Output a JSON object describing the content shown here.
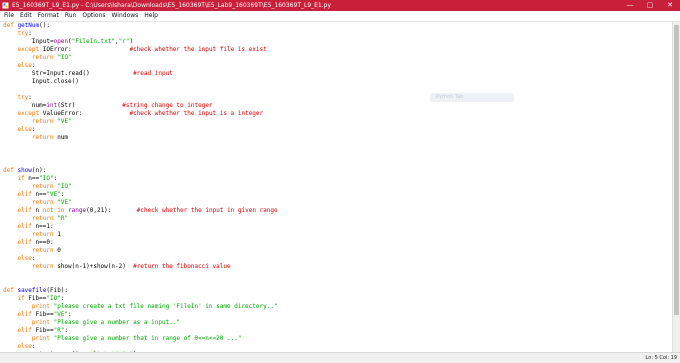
{
  "window": {
    "title": "E5_160369T_L9_E1.py - C:\\Users\\Ishara\\Downloads\\E5_160369T\\E5_Lab9_160369T\\E5_160369T_L9_E1.py",
    "buttons": {
      "minimize": "—",
      "maximize": "▢",
      "close": "✕"
    }
  },
  "menu": [
    "File",
    "Edit",
    "Format",
    "Run",
    "Options",
    "Windows",
    "Help"
  ],
  "ghost_label": "Python Tab",
  "status": {
    "position": "Ln: 5 Col: 19"
  },
  "theme": {
    "title_bg": "#c8203a",
    "keyword": "#ff7700",
    "builtin": "#900090",
    "string": "#00aa00",
    "comment": "#dd0000",
    "defname": "#0000ff"
  },
  "icons": {
    "app": "python-file-icon"
  },
  "code_lines": [
    [
      [
        "kw",
        "def "
      ],
      [
        "df",
        "getNum"
      ],
      [
        "",
        "():"
      ]
    ],
    [
      [
        "",
        "    "
      ],
      [
        "kw",
        "try"
      ],
      [
        "",
        ":"
      ]
    ],
    [
      [
        "",
        "        Input="
      ],
      [
        "bi",
        "open"
      ],
      [
        "",
        "("
      ],
      [
        "st",
        "\"FileIn.txt\""
      ],
      [
        "",
        ","
      ],
      [
        "st",
        "\"r\""
      ],
      [
        "",
        ")"
      ]
    ],
    [
      [
        "",
        "    "
      ],
      [
        "kw",
        "except"
      ],
      [
        "",
        " IOError:"
      ],
      [
        "",
        "                "
      ],
      [
        "cm",
        "#check whether the input file is exist"
      ]
    ],
    [
      [
        "",
        "        "
      ],
      [
        "kw",
        "return"
      ],
      [
        "",
        " "
      ],
      [
        "st",
        "\"IO\""
      ]
    ],
    [
      [
        "",
        "    "
      ],
      [
        "kw",
        "else"
      ],
      [
        "",
        ":"
      ]
    ],
    [
      [
        "",
        "        Str=Input.read()"
      ],
      [
        "",
        "            "
      ],
      [
        "cm",
        "#read input"
      ]
    ],
    [
      [
        "",
        "        Input.close()"
      ]
    ],
    [],
    [
      [
        "",
        "    "
      ],
      [
        "kw",
        "try"
      ],
      [
        "",
        ":"
      ]
    ],
    [
      [
        "",
        "        num="
      ],
      [
        "bi",
        "int"
      ],
      [
        "",
        "(Str)"
      ],
      [
        "",
        "             "
      ],
      [
        "cm",
        "#string change to integer"
      ]
    ],
    [
      [
        "",
        "    "
      ],
      [
        "kw",
        "except"
      ],
      [
        "",
        " ValueError:"
      ],
      [
        "",
        "             "
      ],
      [
        "cm",
        "#check whether the input is a integer"
      ]
    ],
    [
      [
        "",
        "        "
      ],
      [
        "kw",
        "return"
      ],
      [
        "",
        " "
      ],
      [
        "st",
        "\"VE\""
      ]
    ],
    [
      [
        "",
        "    "
      ],
      [
        "kw",
        "else"
      ],
      [
        "",
        ":"
      ]
    ],
    [
      [
        "",
        "        "
      ],
      [
        "kw",
        "return"
      ],
      [
        "",
        " num"
      ]
    ],
    [],
    [],
    [],
    [
      [
        "kw",
        "def "
      ],
      [
        "df",
        "show"
      ],
      [
        "",
        "(n):"
      ]
    ],
    [
      [
        "",
        "    "
      ],
      [
        "kw",
        "if"
      ],
      [
        "",
        " n=="
      ],
      [
        "st",
        "\"IO\""
      ],
      [
        "",
        ":"
      ]
    ],
    [
      [
        "",
        "        "
      ],
      [
        "kw",
        "return"
      ],
      [
        "",
        " "
      ],
      [
        "st",
        "\"IO\""
      ]
    ],
    [
      [
        "",
        "    "
      ],
      [
        "kw",
        "elif"
      ],
      [
        "",
        " n=="
      ],
      [
        "st",
        "\"VE\""
      ],
      [
        "",
        ":"
      ]
    ],
    [
      [
        "",
        "        "
      ],
      [
        "kw",
        "return"
      ],
      [
        "",
        " "
      ],
      [
        "st",
        "\"VE\""
      ]
    ],
    [
      [
        "",
        "    "
      ],
      [
        "kw",
        "elif"
      ],
      [
        "",
        " n "
      ],
      [
        "kw",
        "not in"
      ],
      [
        "",
        " "
      ],
      [
        "bi",
        "range"
      ],
      [
        "",
        "(0,21):"
      ],
      [
        "",
        "       "
      ],
      [
        "cm",
        "#check whether the input in given range"
      ]
    ],
    [
      [
        "",
        "        "
      ],
      [
        "kw",
        "return"
      ],
      [
        "",
        " "
      ],
      [
        "st",
        "\"R\""
      ]
    ],
    [
      [
        "",
        "    "
      ],
      [
        "kw",
        "elif"
      ],
      [
        "",
        " n==1:"
      ]
    ],
    [
      [
        "",
        "        "
      ],
      [
        "kw",
        "return"
      ],
      [
        "",
        " 1"
      ]
    ],
    [
      [
        "",
        "    "
      ],
      [
        "kw",
        "elif"
      ],
      [
        "",
        " n==0:"
      ]
    ],
    [
      [
        "",
        "        "
      ],
      [
        "kw",
        "return"
      ],
      [
        "",
        " 0"
      ]
    ],
    [
      [
        "",
        "    "
      ],
      [
        "kw",
        "else"
      ],
      [
        "",
        ":"
      ]
    ],
    [
      [
        "",
        "        "
      ],
      [
        "kw",
        "return"
      ],
      [
        "",
        " show(n-1)+show(n-2)"
      ],
      [
        "",
        "  "
      ],
      [
        "cm",
        "#return the fibonacci value"
      ]
    ],
    [],
    [],
    [
      [
        "kw",
        "def "
      ],
      [
        "df",
        "savefile"
      ],
      [
        "",
        "(Fib):"
      ]
    ],
    [
      [
        "",
        "    "
      ],
      [
        "kw",
        "if"
      ],
      [
        "",
        " Fib=="
      ],
      [
        "st",
        "\"IO\""
      ],
      [
        "",
        ":"
      ]
    ],
    [
      [
        "",
        "        "
      ],
      [
        "kw",
        "print"
      ],
      [
        "",
        " "
      ],
      [
        "st",
        "\"please create a txt file naming 'FileIn' in same directory..\""
      ]
    ],
    [
      [
        "",
        "    "
      ],
      [
        "kw",
        "elif"
      ],
      [
        "",
        " Fib=="
      ],
      [
        "st",
        "\"VE\""
      ],
      [
        "",
        ":"
      ]
    ],
    [
      [
        "",
        "        "
      ],
      [
        "kw",
        "print"
      ],
      [
        "",
        " "
      ],
      [
        "st",
        "\"Please give a number as a input..\""
      ]
    ],
    [
      [
        "",
        "    "
      ],
      [
        "kw",
        "elif"
      ],
      [
        "",
        " Fib=="
      ],
      [
        "st",
        "\"R\""
      ],
      [
        "",
        ":"
      ]
    ],
    [
      [
        "",
        "        "
      ],
      [
        "kw",
        "print"
      ],
      [
        "",
        " "
      ],
      [
        "st",
        "\"Please give a number that in range of 0<=n<=20 ...\""
      ]
    ],
    [
      [
        "",
        "    "
      ],
      [
        "kw",
        "else"
      ],
      [
        "",
        ":"
      ]
    ],
    [
      [
        "",
        "        output="
      ],
      [
        "bi",
        "open"
      ],
      [
        "",
        "("
      ],
      [
        "st",
        "\"result.txt\""
      ],
      [
        "",
        ","
      ],
      [
        "st",
        "\"w\""
      ],
      [
        "",
        ")"
      ]
    ]
  ]
}
